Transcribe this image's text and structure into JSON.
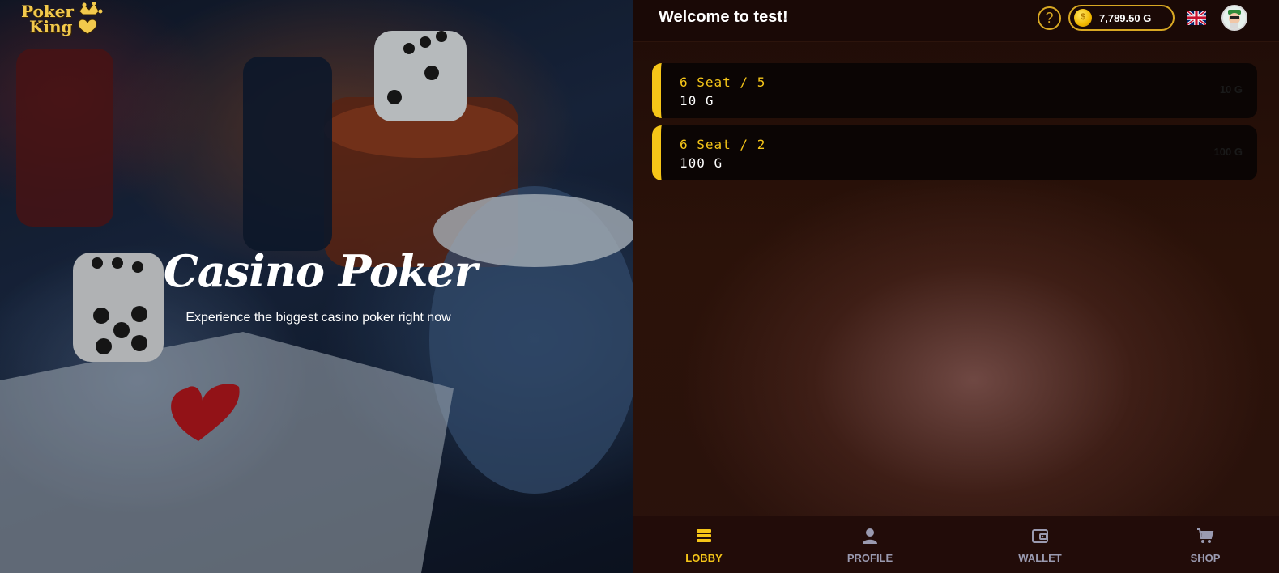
{
  "brand": {
    "line1": "Poker",
    "line2": "King",
    "logo_color": "#f2c94c"
  },
  "hero": {
    "title": "Casino Poker",
    "subtitle": "Experience the biggest casino poker right now"
  },
  "header": {
    "welcome": "Welcome to test!",
    "help_label": "?",
    "coin_symbol": "$",
    "balance": "7,789.50 G",
    "language_icon": "uk-flag-icon",
    "accent_color": "#d8a823"
  },
  "rooms": [
    {
      "name": "6 Seat / 5",
      "buyin": "10 G",
      "side_label": "10 G"
    },
    {
      "name": "6 Seat / 2",
      "buyin": "100 G",
      "side_label": "100 G"
    }
  ],
  "nav": {
    "items": [
      {
        "label": "LOBBY",
        "icon": "lobby-stack-icon",
        "active": true
      },
      {
        "label": "PROFILE",
        "icon": "person-icon",
        "active": false
      },
      {
        "label": "WALLET",
        "icon": "wallet-icon",
        "active": false
      },
      {
        "label": "SHOP",
        "icon": "cart-icon",
        "active": false
      }
    ],
    "active_color": "#f5c518",
    "inactive_color": "#9a9ab0"
  }
}
